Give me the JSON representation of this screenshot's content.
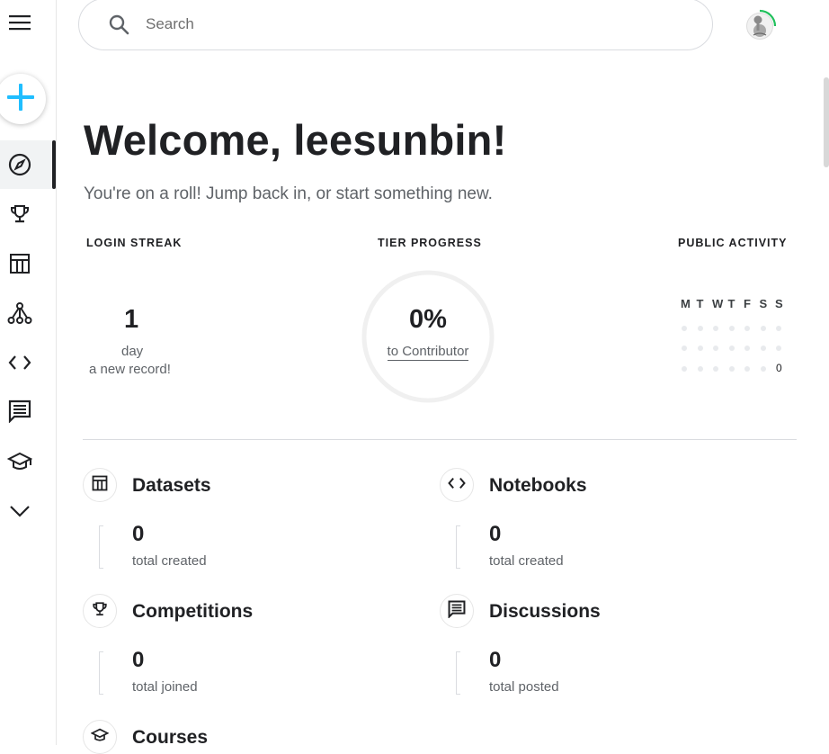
{
  "search": {
    "placeholder": "Search"
  },
  "sidebar": {
    "menu_icon": "hamburger-icon",
    "create_icon": "plus-icon",
    "items": [
      {
        "name": "explore",
        "icon": "compass-icon",
        "active": true
      },
      {
        "name": "competitions",
        "icon": "trophy-icon"
      },
      {
        "name": "datasets",
        "icon": "table-icon"
      },
      {
        "name": "models",
        "icon": "model-graph-icon"
      },
      {
        "name": "code",
        "icon": "code-icon"
      },
      {
        "name": "discussions",
        "icon": "comment-icon"
      },
      {
        "name": "learn",
        "icon": "graduation-cap-icon"
      },
      {
        "name": "more",
        "icon": "chevron-down-icon"
      }
    ]
  },
  "welcome": {
    "title": "Welcome, leesunbin!",
    "subtitle": "You're on a roll! Jump back in, or start something new."
  },
  "stats": {
    "login_streak": {
      "label": "LOGIN STREAK",
      "value": "1",
      "unit": "day",
      "note": "a new record!"
    },
    "tier_progress": {
      "label": "TIER PROGRESS",
      "value": "0%",
      "link": "to Contributor",
      "progress": 0
    },
    "public_activity": {
      "label": "PUBLIC ACTIVITY",
      "days": [
        "M",
        "T",
        "W",
        "T",
        "F",
        "S",
        "S"
      ],
      "today_value": "0"
    }
  },
  "cards": [
    {
      "title": "Datasets",
      "count": "0",
      "caption": "total created",
      "icon": "table-icon"
    },
    {
      "title": "Notebooks",
      "count": "0",
      "caption": "total created",
      "icon": "code-icon"
    },
    {
      "title": "Competitions",
      "count": "0",
      "caption": "total joined",
      "icon": "trophy-icon"
    },
    {
      "title": "Discussions",
      "count": "0",
      "caption": "total posted",
      "icon": "comment-icon"
    },
    {
      "title": "Courses",
      "icon": "graduation-cap-icon"
    }
  ],
  "colors": {
    "accent": "#20beff",
    "progress_ring": "#20c05c",
    "text": "#202124",
    "muted": "#5f6368"
  }
}
